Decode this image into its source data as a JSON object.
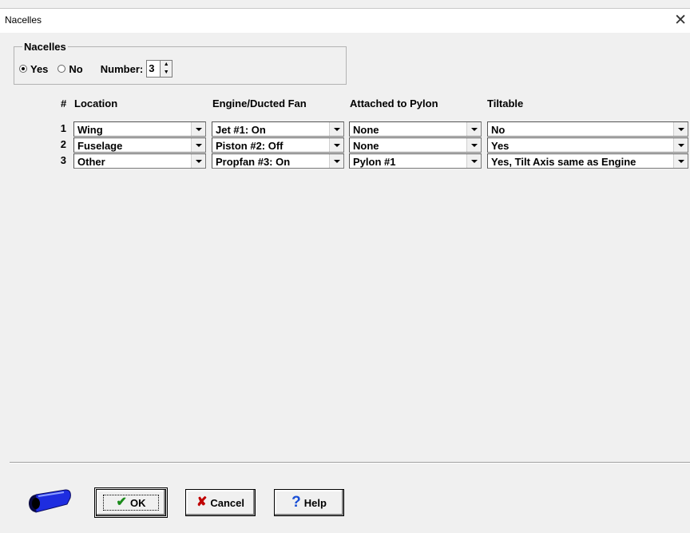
{
  "window": {
    "title": "Nacelles",
    "close_glyph": "✕"
  },
  "nacelles_group": {
    "legend": "Nacelles",
    "yes_label": "Yes",
    "no_label": "No",
    "selected": "Yes",
    "number_label": "Number:",
    "number_value": "3"
  },
  "table": {
    "headers": {
      "num": "#",
      "location": "Location",
      "engine": "Engine/Ducted Fan",
      "pylon": "Attached to Pylon",
      "tiltable": "Tiltable"
    },
    "rows": [
      {
        "num": "1",
        "location": "Wing",
        "engine": "Jet #1: On",
        "pylon": "None",
        "tiltable": "No"
      },
      {
        "num": "2",
        "location": "Fuselage",
        "engine": "Piston #2: Off",
        "pylon": "None",
        "tiltable": "Yes"
      },
      {
        "num": "3",
        "location": "Other",
        "engine": "Propfan #3: On",
        "pylon": "Pylon #1",
        "tiltable": "Yes, Tilt Axis same as Engine"
      }
    ]
  },
  "buttons": {
    "ok": "OK",
    "cancel": "Cancel",
    "help": "Help"
  },
  "icons": {
    "ok": "check-icon",
    "cancel": "x-icon",
    "help": "question-icon",
    "logo": "nacelle-icon"
  },
  "colors": {
    "ok_check": "#1a8a1a",
    "cancel_x": "#c00000",
    "help_q": "#1a4fd6",
    "nacelle_blue": "#1e2de0"
  }
}
